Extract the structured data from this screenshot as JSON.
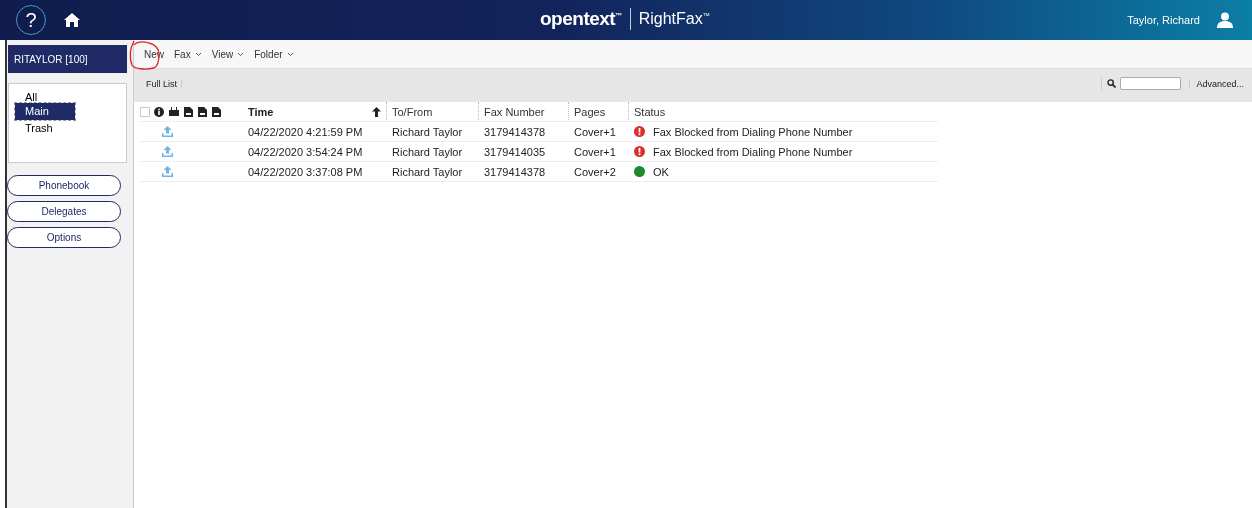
{
  "header": {
    "help": "?",
    "brand": "opentext$^{™}$",
    "product": "RightFax$^{™}$",
    "user": "Taylor, Richard"
  },
  "sidebar": {
    "account": "RITAYLOR [100]",
    "folders": [
      {
        "label": "All",
        "selected": false
      },
      {
        "label": "Main",
        "selected": true
      },
      {
        "label": "Trash",
        "selected": false
      }
    ],
    "buttons": [
      "Phonebook",
      "Delegates",
      "Options"
    ]
  },
  "toolbar": [
    {
      "label": "New",
      "kind": "action"
    },
    {
      "label": "Fax",
      "kind": "menu"
    },
    {
      "label": "View",
      "kind": "menu"
    },
    {
      "label": "Folder",
      "kind": "menu"
    }
  ],
  "filter": {
    "label": "Full List",
    "advanced": "Advanced..."
  },
  "table": {
    "select_all": {
      "checked": false
    },
    "columns": [
      "Time",
      "To/From",
      "Fax Number",
      "Pages",
      "Status"
    ],
    "rows": [
      {
        "time": "04/22/2020 4:21:59 PM",
        "to_from": "Richard Taylor",
        "fax_number": "3179414378",
        "pages": "Cover+1",
        "status": "Fax Blocked from Dialing Phone Number",
        "kind": "error"
      },
      {
        "time": "04/22/2020 3:54:24 PM",
        "to_from": "Richard Taylor",
        "fax_number": "3179414035",
        "pages": "Cover+1",
        "status": "Fax Blocked from Dialing Phone Number",
        "kind": "error"
      },
      {
        "time": "04/22/2020 3:37:08 PM",
        "to_from": "Richard Taylor",
        "fax_number": "3179414378",
        "pages": "Cover+2",
        "status": "OK",
        "kind": "ok"
      }
    ]
  }
}
